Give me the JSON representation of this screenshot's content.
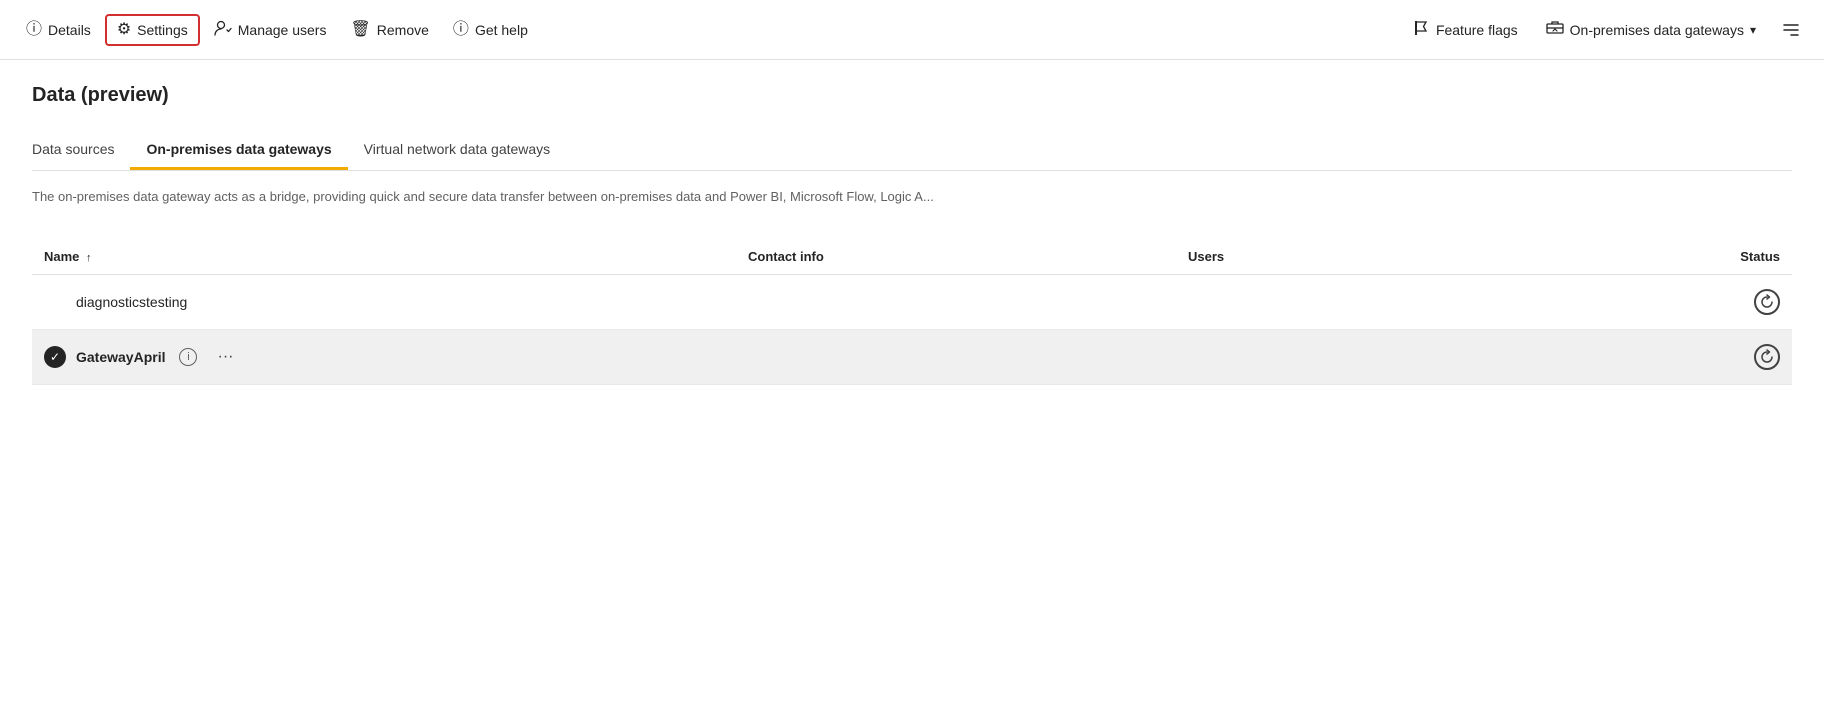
{
  "toolbar": {
    "details_label": "Details",
    "settings_label": "Settings",
    "manage_users_label": "Manage users",
    "remove_label": "Remove",
    "get_help_label": "Get help",
    "feature_flags_label": "Feature flags",
    "on_premises_dropdown_label": "On-premises data gateways"
  },
  "page": {
    "title": "Data (preview)",
    "description": "The on-premises data gateway acts as a bridge, providing quick and secure data transfer between on-premises data and Power BI, Microsoft Flow, Logic A..."
  },
  "tabs": [
    {
      "id": "data-sources",
      "label": "Data sources",
      "active": false
    },
    {
      "id": "on-premises",
      "label": "On-premises data gateways",
      "active": true
    },
    {
      "id": "virtual-network",
      "label": "Virtual network data gateways",
      "active": false
    }
  ],
  "table": {
    "columns": [
      {
        "id": "name",
        "label": "Name",
        "sort": "↑"
      },
      {
        "id": "contact",
        "label": "Contact info"
      },
      {
        "id": "users",
        "label": "Users"
      },
      {
        "id": "status",
        "label": "Status"
      }
    ],
    "rows": [
      {
        "id": "row-1",
        "selected": false,
        "check": false,
        "name": "diagnosticstesting",
        "contact": "",
        "users": "",
        "status": "refresh"
      },
      {
        "id": "row-2",
        "selected": true,
        "check": true,
        "name": "GatewayApril",
        "contact": "",
        "users": "",
        "status": "refresh"
      }
    ]
  }
}
